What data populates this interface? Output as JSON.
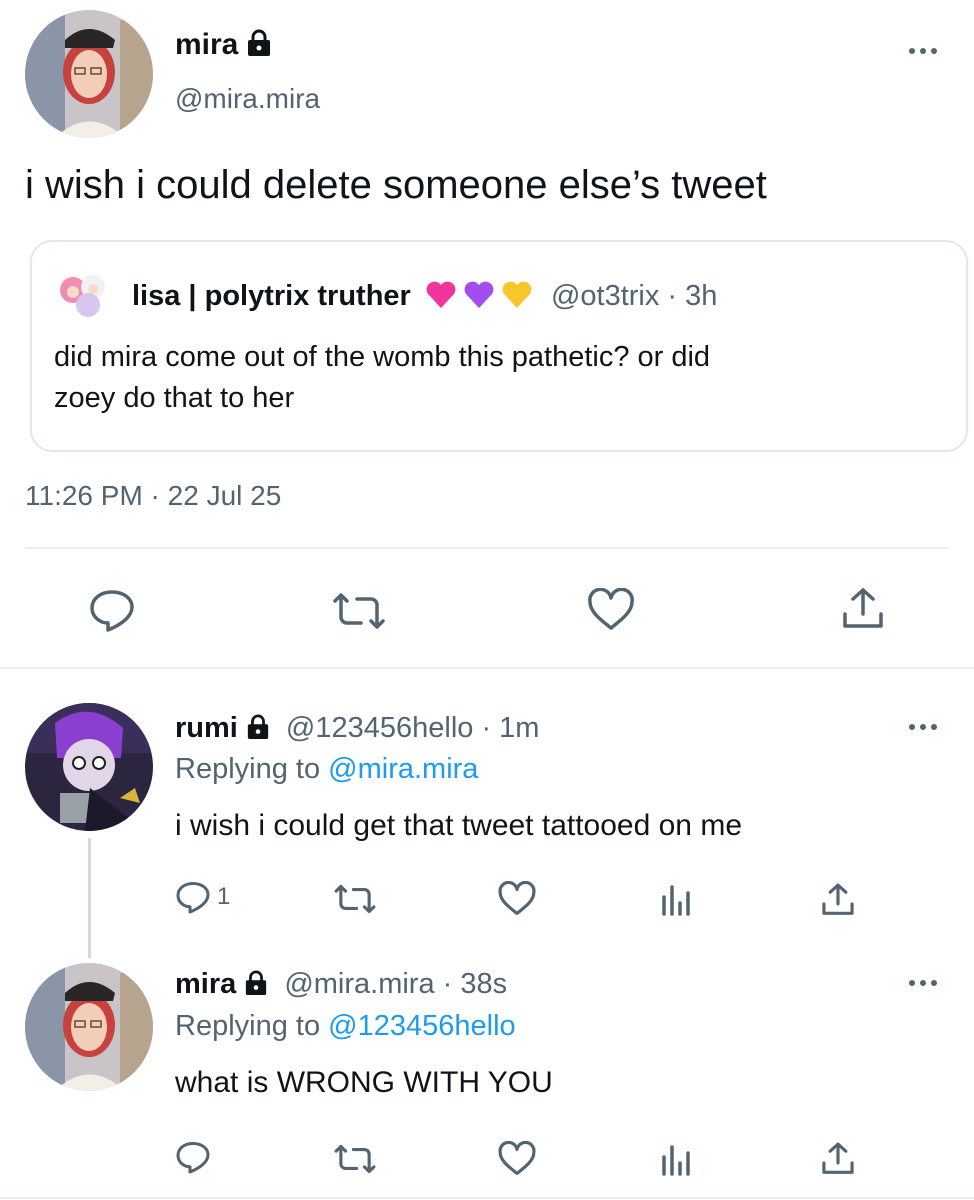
{
  "main_tweet": {
    "display_name": "mira",
    "handle": "@mira.mira",
    "text": "i wish i could delete someone else’s tweet",
    "timestamp": "11:26 PM · 22 Jul 25",
    "quoted": {
      "display_name": "lisa | polytrix truther",
      "handle_time": "@ot3trix · 3h",
      "text_line1": "did mira come out of the womb this pathetic? or did",
      "text_line2": "zoey do that to her",
      "hearts": [
        "#f0359d",
        "#a34cf0",
        "#f7c62b"
      ]
    }
  },
  "reply1": {
    "display_name": "rumi",
    "handle_time": "@123456hello · 1m",
    "replying_prefix": "Replying to ",
    "replying_to": "@mira.mira",
    "text": "i wish i could get that tweet tattooed on me",
    "reply_count": "1"
  },
  "reply2": {
    "display_name": "mira",
    "handle_time": "@mira.mira · 38s",
    "replying_prefix": "Replying to ",
    "replying_to": "@123456hello",
    "text": "what is WRONG WITH YOU"
  },
  "colors": {
    "link": "#1d9bf0",
    "muted": "#536471",
    "divider": "#eceff1"
  },
  "icons": [
    "lock-icon",
    "more-icon",
    "reply-icon",
    "retweet-icon",
    "like-icon",
    "share-icon",
    "analytics-icon"
  ]
}
